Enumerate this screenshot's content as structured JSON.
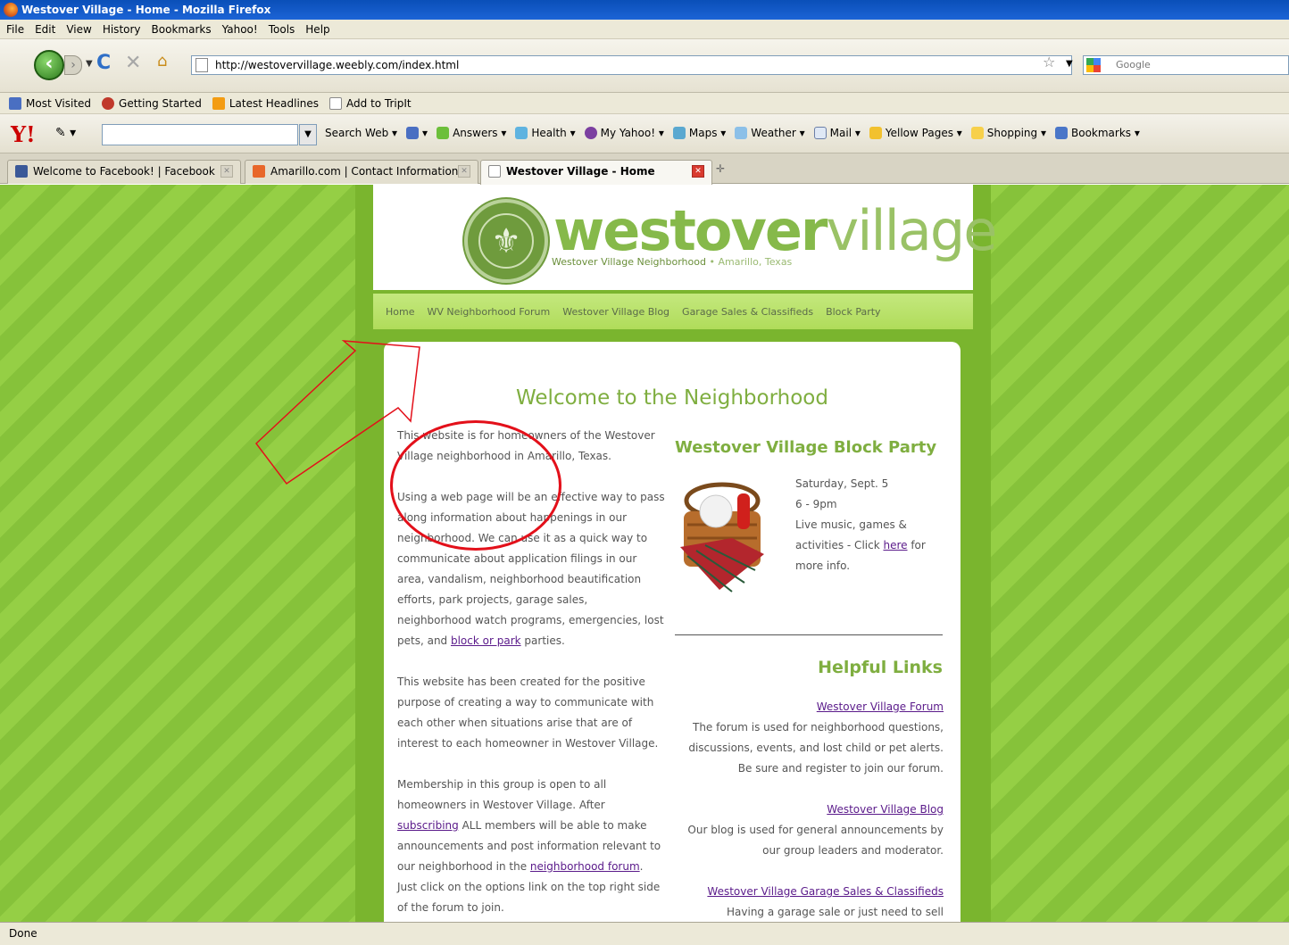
{
  "window": {
    "title": "Westover Village - Home - Mozilla Firefox"
  },
  "menu": [
    "File",
    "Edit",
    "View",
    "History",
    "Bookmarks",
    "Yahoo!",
    "Tools",
    "Help"
  ],
  "nav": {
    "url": "http://westovervillage.weebly.com/index.html",
    "search_placeholder": "Google"
  },
  "bookmarks": [
    {
      "label": "Most Visited",
      "icon": "most-visited-icon",
      "color": "#4a6fc2"
    },
    {
      "label": "Getting Started",
      "icon": "firefox-icon",
      "color": "#c0392b"
    },
    {
      "label": "Latest Headlines",
      "icon": "rss-icon",
      "color": "#f39c12"
    },
    {
      "label": "Add to TripIt",
      "icon": "page-icon",
      "color": "#ffffff"
    }
  ],
  "yahoo_toolbar": {
    "logo": "Y!",
    "search_web": "Search Web",
    "links": [
      "Answers",
      "Health",
      "My Yahoo!",
      "Maps",
      "Weather",
      "Mail",
      "Yellow Pages",
      "Shopping",
      "Bookmarks"
    ]
  },
  "tabs": [
    {
      "label": "Welcome to Facebook! | Facebook",
      "color": "#3b5998"
    },
    {
      "label": "Amarillo.com | Contact Information",
      "color": "#e8672a"
    },
    {
      "label": "Westover Village - Home",
      "color": "#ffffff"
    }
  ],
  "site": {
    "logo_bold": "westover",
    "logo_light": "village",
    "tagline": "Westover Village Neighborhood",
    "tagline_sep": "•",
    "tagline_city": "Amarillo, Texas",
    "nav": [
      "Home",
      "WV Neighborhood Forum",
      "Westover Village Blog",
      "Garage Sales & Classifieds",
      "Block Party"
    ],
    "welcome": "Welcome to the Neighborhood",
    "p1": "This website is for homeowners of the Westover Village neighborhood in Amarillo, Texas.",
    "p2a": "Using a web page will be an effective way to pass along information about happenings in our neighborhood. We can use it as a quick way to communicate about application filings in our area, vandalism, neighborhood beautification efforts, park projects, garage sales, neighborhood watch programs, emergencies, lost pets, and ",
    "p2_link": "block or park",
    "p2b": " parties.",
    "p3": "This website has been created for the positive purpose of creating a way to communicate with each other when situations arise that are of interest to each homeowner in Westover Village.",
    "p4a": "Membership in this group is open to all homeowners in Westover Village. After ",
    "p4_link1": "subscribing",
    "p4b": " ALL members will be able to make announcements and post information relevant to our neighborhood in the ",
    "p4_link2": "neighborhood forum",
    "p4c": ". Just click on the options link on the top right side of the forum to join.",
    "block_party": {
      "title": "Westover Village Block Party",
      "date": "Saturday, Sept. 5",
      "time": "6 - 9pm",
      "desc_a": "Live music, games & activities - Click ",
      "link": "here",
      "desc_b": " for more info."
    },
    "helpful_links": {
      "title": "Helpful Links",
      "items": [
        {
          "link": "Westover Village Forum",
          "desc": "The forum is used for neighborhood questions, discussions, events, and lost child or pet alerts. Be sure and register to join our forum."
        },
        {
          "link": "Westover Village Blog",
          "desc": "Our blog is used for general announcements by our group leaders and moderator."
        },
        {
          "link": "Westover Village Garage Sales & Classifieds",
          "desc": "Having a garage sale or just need to sell"
        }
      ]
    }
  },
  "status": "Done"
}
